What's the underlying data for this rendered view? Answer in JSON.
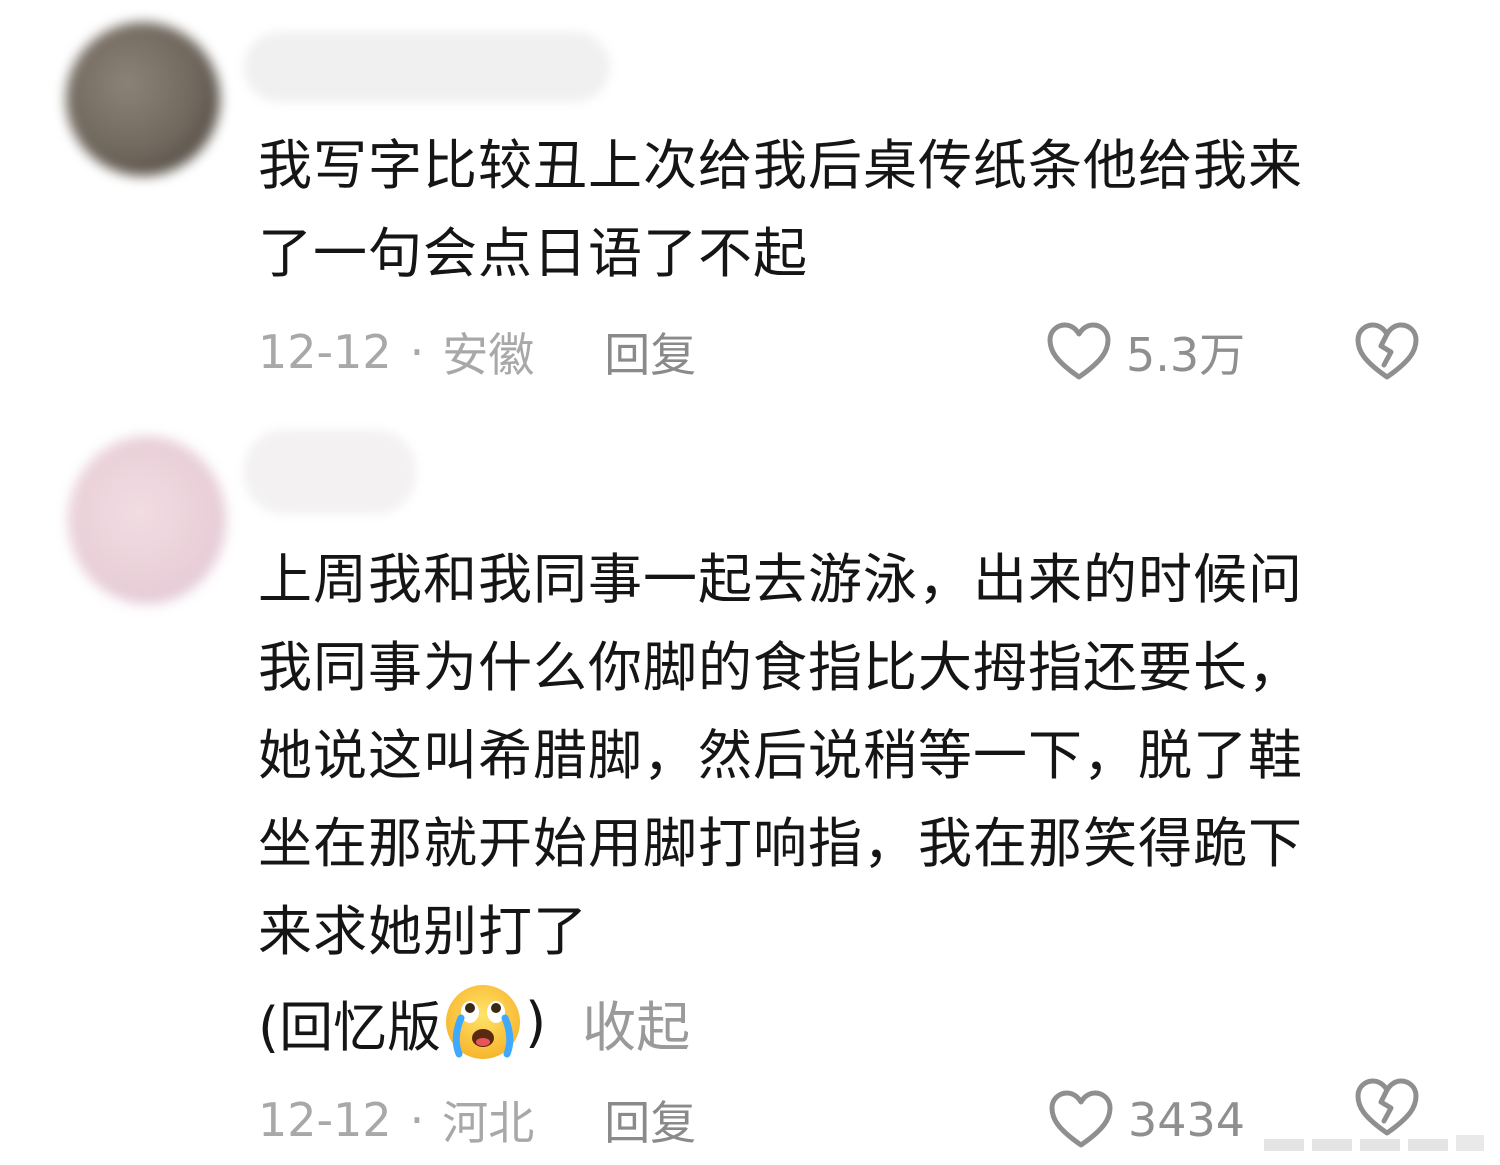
{
  "comments": [
    {
      "text": "我写字比较丑上次给我后桌传纸条他给我来\n了一句会点日语了不起",
      "date": "12-12",
      "separator": "·",
      "location": "安徽",
      "reply_label": "回复",
      "like_count": "5.3万",
      "icons": [
        "heart-outline-icon",
        "broken-heart-icon"
      ]
    },
    {
      "text": "上周我和我同事一起去游泳，出来的时候问\n我同事为什么你脚的食指比大拇指还要长，\n她说这叫希腊脚，然后说稍等一下，脱了鞋\n坐在那就开始用脚打响指，我在那笑得跪下\n来求她别打了",
      "extra_prefix": "(回忆版",
      "extra_suffix": ")",
      "emoji": "crying-face-emoji",
      "collapse_label": "收起",
      "date": "12-12",
      "separator": "·",
      "location": "河北",
      "reply_label": "回复",
      "like_count": "3434",
      "icons": [
        "heart-outline-icon",
        "broken-heart-icon"
      ]
    }
  ]
}
